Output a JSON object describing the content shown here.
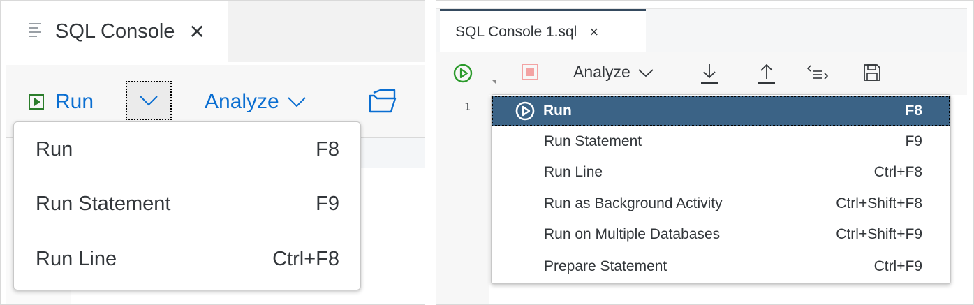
{
  "left": {
    "tab": {
      "title": "SQL Console",
      "close": "✕"
    },
    "toolbar": {
      "run_label": "Run",
      "analyze_label": "Analyze"
    },
    "menu": [
      {
        "label": "Run",
        "shortcut": "F8"
      },
      {
        "label": "Run Statement",
        "shortcut": "F9"
      },
      {
        "label": "Run Line",
        "shortcut": "Ctrl+F8"
      }
    ]
  },
  "right": {
    "tab": {
      "title": "SQL Console 1.sql",
      "close": "×"
    },
    "toolbar": {
      "analyze_label": "Analyze"
    },
    "editor": {
      "line_number": "1"
    },
    "menu": [
      {
        "label": "Run",
        "shortcut": "F8",
        "selected": true
      },
      {
        "label": "Run Statement",
        "shortcut": "F9"
      },
      {
        "label": "Run Line",
        "shortcut": "Ctrl+F8"
      },
      {
        "label": "Run as Background Activity",
        "shortcut": "Ctrl+Shift+F8"
      },
      {
        "label": "Run on Multiple Databases",
        "shortcut": "Ctrl+Shift+F9"
      },
      {
        "label": "Prepare Statement",
        "shortcut": "Ctrl+F9"
      }
    ]
  },
  "colors": {
    "accent_blue": "#0a6ed1",
    "run_green": "#2b7d2b",
    "selected_bg": "#3b6386",
    "stop_red": "#f3a3a3"
  }
}
